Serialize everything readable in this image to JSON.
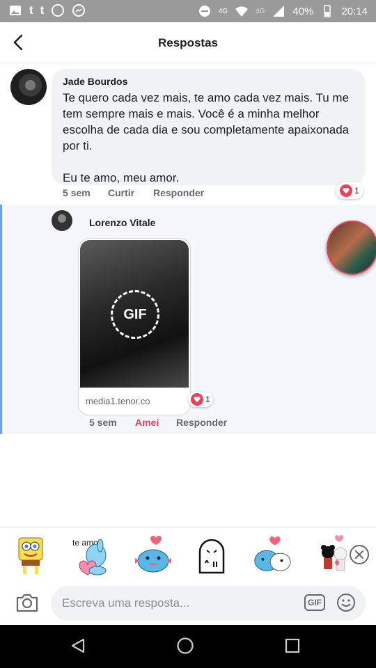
{
  "status_bar": {
    "battery": "40%",
    "time": "20:14",
    "network_1": "4G",
    "network_2": "4G"
  },
  "header": {
    "title": "Respostas"
  },
  "comment": {
    "author": "Jade Bourdos",
    "text": "Te quero cada vez mais, te amo cada vez mais. Tu me tem sempre mais e mais. Você é a minha melhor escolha de cada dia e sou completamente apaixonada por ti.\n\nEu te amo, meu amor.",
    "time": "5 sem",
    "like_label": "Curtir",
    "reply_label": "Responder",
    "reaction_count": "1"
  },
  "reply": {
    "author": "Lorenzo Vitale",
    "gif_badge": "GIF",
    "gif_source": "media1.tenor.co",
    "time": "5 sem",
    "reacted_label": "Amei",
    "reply_label": "Responder",
    "reaction_count": "1"
  },
  "stickers": [
    {
      "name": "spongebob-sticker"
    },
    {
      "name": "te-amo-dog-sticker",
      "text": "te amo"
    },
    {
      "name": "blue-cat-hearts-sticker"
    },
    {
      "name": "ghost-sticker"
    },
    {
      "name": "blue-cat-hug-sticker"
    },
    {
      "name": "couple-sticker"
    }
  ],
  "composer": {
    "placeholder": "Escreva uma resposta...",
    "gif_label": "GIF"
  },
  "colors": {
    "love": "#f33e58",
    "thread_line": "#6d9cf0"
  }
}
